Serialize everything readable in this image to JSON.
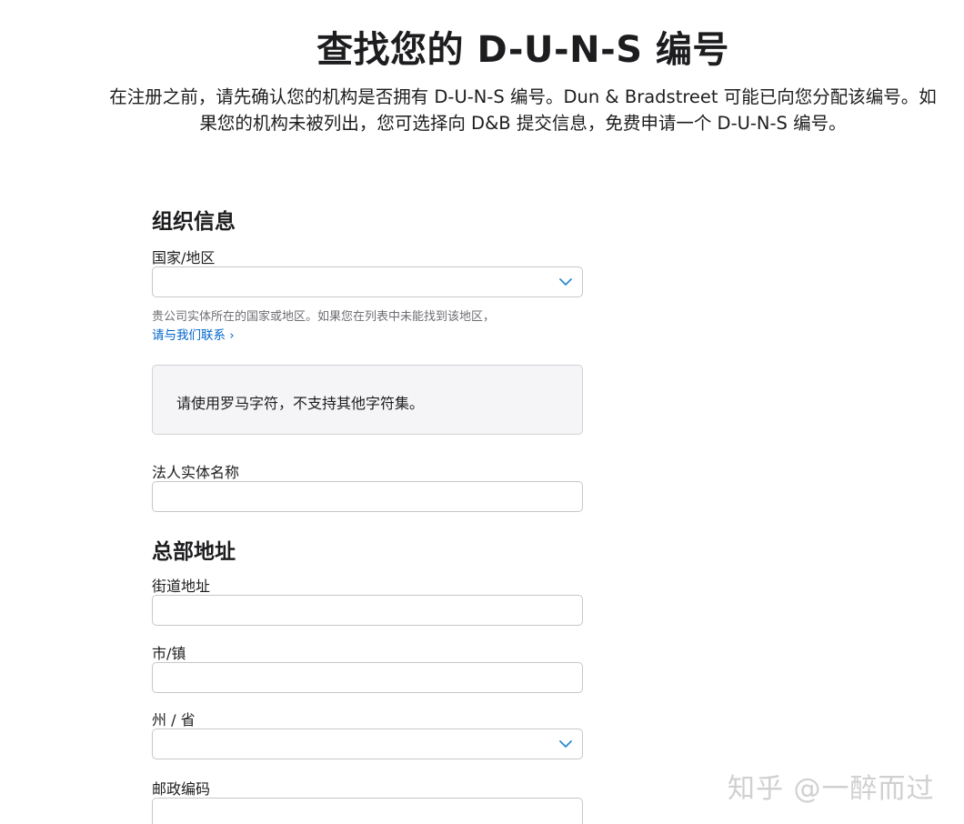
{
  "header": {
    "title": "查找您的 D-U-N-S 编号",
    "intro": "在注册之前，请先确认您的机构是否拥有 D-U-N-S 编号。Dun & Bradstreet 可能已向您分配该编号。如果您的机构未被列出，您可选择向 D&B 提交信息，免费申请一个 D-U-N-S 编号。"
  },
  "org_section": {
    "title": "组织信息",
    "country": {
      "label": "国家/地区",
      "value": "",
      "help": "贵公司实体所在的国家或地区。如果您在列表中未能找到该地区，",
      "contact_link": "请与我们联系 ›"
    },
    "notice": "请使用罗马字符，不支持其他字符集。",
    "legal_name": {
      "label": "法人实体名称",
      "value": ""
    }
  },
  "address_section": {
    "title": "总部地址",
    "street": {
      "label": "街道地址",
      "value": ""
    },
    "city": {
      "label": "市/镇",
      "value": ""
    },
    "state": {
      "label": "州 / 省",
      "value": ""
    },
    "postal": {
      "label": "邮政编码",
      "value": ""
    }
  },
  "watermark": "知乎 @一醉而过",
  "colors": {
    "accent": "#0066cc",
    "chevron": "#2a8bd1",
    "border": "#c7c7cc",
    "notice_bg": "#f5f5f7"
  }
}
